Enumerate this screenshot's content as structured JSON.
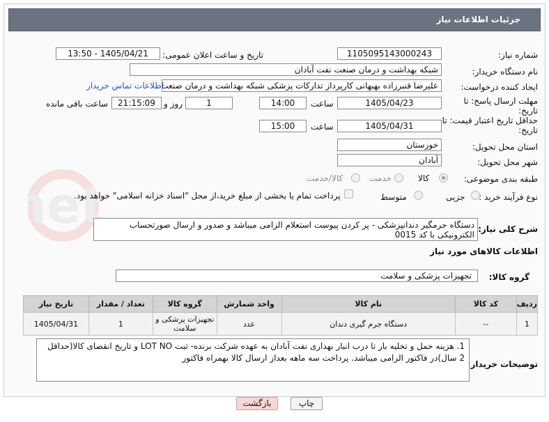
{
  "header": {
    "title": "جزئیات اطلاعات نیاز"
  },
  "fields": {
    "need_number": {
      "label": "شماره نیاز:",
      "value": "1105095143000243"
    },
    "announce_datetime": {
      "label": "تاریخ و ساعت اعلان عمومی:",
      "value": "1405/04/21 - 13:50"
    },
    "buyer_org": {
      "label": "نام دستگاه خریدار:",
      "value": "شبکه بهداشت و درمان صنعت نفت آبادان"
    },
    "requester": {
      "label": "ایجاد کننده درخواست:",
      "value": "علیرضا قنبرزاده بهبهانی کارپرداز تدارکات پزشکی شبکه بهداشت و درمان صنعت",
      "contact_link": "اطلاعات تماس خریدار"
    },
    "reply_deadline": {
      "label": "مهلت ارسال پاسخ: تا تاریخ:",
      "date": "1405/04/23",
      "time_label": "ساعت",
      "time": "14:00",
      "days": "1",
      "days_label": "روز و",
      "remaining": "21:15:09",
      "remaining_label": "ساعت باقی مانده"
    },
    "price_validity": {
      "label": "حداقل تاریخ اعتبار قیمت: تا تاریخ:",
      "date": "1405/04/31",
      "time_label": "ساعت",
      "time": "15:00"
    },
    "province": {
      "label": "استان محل تحویل:",
      "value": "خوزستان"
    },
    "city": {
      "label": "شهر محل تحویل:",
      "value": "آبادان"
    },
    "category": {
      "label": "طبقه بندی موضوعی:",
      "options": [
        "کالا",
        "خدمت",
        "کالا/خدمت"
      ],
      "selected": "کالا"
    },
    "purchase_process": {
      "label": "نوع فرآیند خرید :",
      "options": [
        "جزیی",
        "متوسط"
      ],
      "note": "پرداخت تمام یا بخشی از مبلغ خرید،از محل \"اسناد خزانه اسلامی\" خواهد بود."
    },
    "general_description": {
      "label": "شرح کلی نیاز:",
      "value": "دستگاه جرمگیر دندانپزشکی  - پر کردن پیوست استعلام الزامی میباشد و صدور  و ارسال صورتحساب الکترونیکی با کد 0015"
    }
  },
  "goods_section": {
    "title": "اطلاعات کالاهای مورد نیاز",
    "group_label": "گروه کالا:",
    "group_value": "تجهیزات پزشکی و سلامت"
  },
  "items_table": {
    "columns": [
      "ردیف",
      "کد کالا",
      "نام کالا",
      "واحد شمارش",
      "گروه کالا",
      "تعداد / مقدار",
      "تاریخ نیاز"
    ],
    "rows": [
      [
        "1",
        "--",
        "دستگاه جرم گیری دندان",
        "عدد",
        "تجهیزات پزشکی و سلامت",
        "1",
        "1405/04/31"
      ]
    ]
  },
  "buyer_notes": {
    "label": "توضیحات خریدار:",
    "value": "1.     هزینه حمل و تخلیه بار تا درب انبار بهداری نفت آبادان به عهده شرکت برنده- ثبت LOT NO و تاریخ انقضای کالا(حداقل 2 سال)در فاکتور الزامی میباشد. پرداخت سه ماهه بعداز ارسال کالا بهمراه فاکتور"
  },
  "buttons": {
    "print": "چاپ",
    "back": "بازگشت"
  },
  "colors": {
    "header_bg": "#6b7280",
    "link": "#1f5fbf",
    "back_btn_bg": "#f7d7d7"
  }
}
